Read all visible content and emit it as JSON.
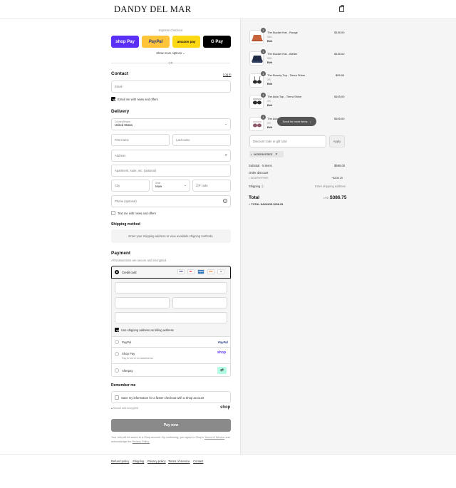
{
  "header": {
    "brand": "DANDY DEL MAR"
  },
  "express": {
    "label": "Express checkout",
    "shop_pay": "shop Pay",
    "paypal": "PayPal",
    "amazon_pay": "amazon pay",
    "gpay": "G Pay",
    "more_options": "Show more options",
    "or": "OR"
  },
  "contact": {
    "heading": "Contact",
    "login": "Log in",
    "email_placeholder": "Email",
    "newsletter_label": "Email me with news and offers"
  },
  "delivery": {
    "heading": "Delivery",
    "country_label": "Country/Region",
    "country_value": "United States",
    "first_name": "First name",
    "last_name": "Last name",
    "address": "Address",
    "apartment": "Apartment, suite, etc. (optional)",
    "city": "City",
    "state_label": "State",
    "state_value": "Iowa",
    "zip": "ZIP code",
    "phone": "Phone (optional)",
    "text_offers": "Text me with news and offers"
  },
  "shipping": {
    "heading": "Shipping method",
    "note": "Enter your shipping address to view available shipping methods."
  },
  "payment": {
    "heading": "Payment",
    "secure_note": "All transactions are secure and encrypted.",
    "credit_card": "Credit card",
    "card_brands": [
      "VISA",
      "MC",
      "AMEX",
      "DISC",
      "+4"
    ],
    "billing_label": "Use shipping address as billing address",
    "paypal": "PayPal",
    "paypal_logo": "PayPal",
    "shop_pay": "Shop Pay",
    "shop_pay_sub": "Pay in full or in installments",
    "shop_logo": "shop",
    "afterpay": "Afterpay"
  },
  "remember": {
    "heading": "Remember me",
    "save_label": "Save my information for a faster checkout with a Shop account",
    "secure": "Secure and encrypted",
    "shop_logo": "shop"
  },
  "pay_now": "Pay now",
  "terms": {
    "text": "Your info will be saved to a Shop account. By continuing, you agree to Shop's",
    "tos_link": "Terms of Service",
    "and_text": "and acknowledge the",
    "privacy_link": "Privacy Policy."
  },
  "footer": {
    "links": [
      "Refund policy",
      "Shipping",
      "Privacy policy",
      "Terms of service",
      "Contact"
    ]
  },
  "cart": {
    "items": [
      {
        "qty": "1",
        "name": "The Bucket Hat - Rouge",
        "variant": "S/M",
        "edit": "Edit",
        "price": "$135.00"
      },
      {
        "qty": "1",
        "name": "The Bucket Hat - Atelier",
        "variant": "S/M",
        "edit": "Edit",
        "price": "$135.00"
      },
      {
        "qty": "1",
        "name": "The Bounty Top - Tierra Shine",
        "variant": "XS",
        "edit": "Edit",
        "price": "$95.00"
      },
      {
        "qty": "1",
        "name": "The Aida Top - Tierra Shine",
        "variant": "XS",
        "edit": "Edit",
        "price": "$105.00"
      },
      {
        "qty": "1",
        "name": "The Aida",
        "variant": "XS",
        "edit": "Edit",
        "price": "$105.00"
      }
    ],
    "scroll_hint": "Scroll for more items",
    "discount_placeholder": "Discount code or gift card",
    "apply": "Apply",
    "code": "MODPAYFREE",
    "subtotal_label": "Subtotal · 5 items",
    "subtotal_value": "$595.00",
    "order_discount_label": "Order discount",
    "discount_code": "MODPAYFREE",
    "discount_value": "−$208.25",
    "shipping_label": "Shipping",
    "shipping_value": "Enter shipping address",
    "total_label": "Total",
    "currency": "USD",
    "total_value": "$386.75",
    "savings_label": "TOTAL SAVINGS",
    "savings_value": "$208.25"
  },
  "colors": {
    "shop_pay": "#5a31f4",
    "paypal": "#ffc439",
    "amazon": "#ffd814",
    "gpay": "#000000",
    "pay_now": "#8a8a8a"
  }
}
